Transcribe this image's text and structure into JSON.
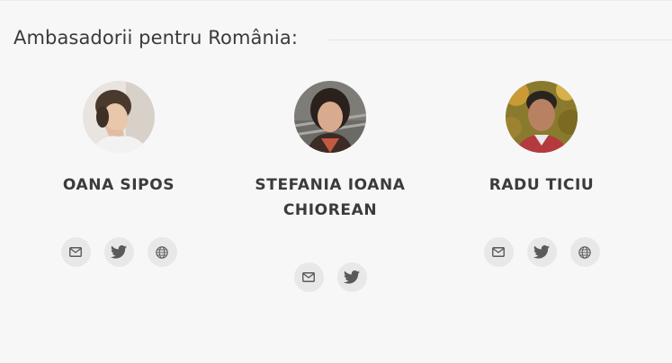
{
  "section": {
    "title": "Ambasadorii pentru România:"
  },
  "ambassadors": [
    {
      "name": "OANA SIPOS",
      "links": [
        "email-icon",
        "twitter-icon",
        "globe-icon"
      ]
    },
    {
      "name": "STEFANIA IOANA CHIOREAN",
      "links": [
        "email-icon",
        "twitter-icon"
      ]
    },
    {
      "name": "RADU TICIU",
      "links": [
        "email-icon",
        "twitter-icon",
        "globe-icon"
      ]
    }
  ],
  "colors": {
    "background": "#f7f7f7",
    "icon_bg": "#e8e8e8",
    "icon": "#5a5a5a",
    "text": "#3b3b3b"
  }
}
